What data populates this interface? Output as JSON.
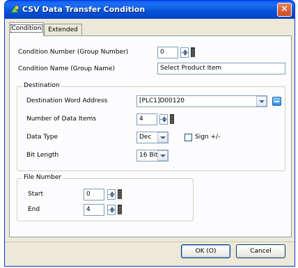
{
  "window": {
    "title": "CSV Data Transfer Condition",
    "close_glyph": "✕"
  },
  "tabs": [
    {
      "label": "Condition",
      "active": true
    },
    {
      "label": "Extended",
      "active": false
    }
  ],
  "condition": {
    "number_label": "Condition Number (Group Number)",
    "number_value": "0",
    "name_label": "Condition Name (Group Name)",
    "name_value": "Select Product Item"
  },
  "destination": {
    "group_title": "Destination",
    "address_label": "Destination Word Address",
    "address_value": "[PLC1]D00120",
    "items_label": "Number of Data Items",
    "items_value": "4",
    "type_label": "Data Type",
    "type_value": "Dec",
    "sign_label": "Sign +/-",
    "sign_checked": false,
    "bitlen_label": "Bit Length",
    "bitlen_value": "16 Bit"
  },
  "file_number": {
    "group_title": "File Number",
    "start_label": "Start",
    "start_value": "0",
    "end_label": "End",
    "end_value": "4"
  },
  "buttons": {
    "ok_label": "OK (O)",
    "cancel_label": "Cancel"
  },
  "icons": {
    "title_icon": "csv-transfer-icon",
    "spin": "spin-arrows-icon",
    "keypad": "keypad-icon",
    "address_input": "address-input-icon",
    "dropdown": "chevron-down-icon"
  }
}
